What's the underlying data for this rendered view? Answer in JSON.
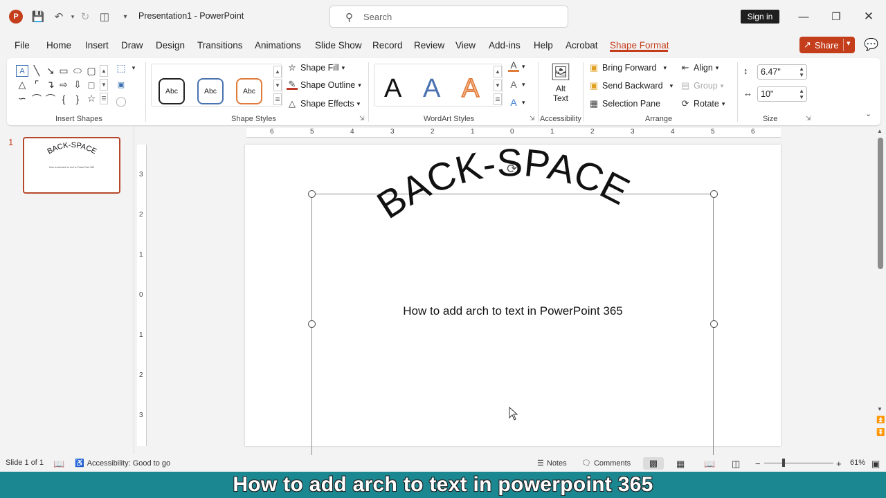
{
  "app": {
    "title": "Presentation1  -  PowerPoint",
    "logo_letter": "P",
    "search_placeholder": "Search",
    "signin": "Sign in",
    "share": "Share"
  },
  "menu": {
    "tabs": [
      "File",
      "Home",
      "Insert",
      "Draw",
      "Design",
      "Transitions",
      "Animations",
      "Slide Show",
      "Record",
      "Review",
      "View",
      "Add-ins",
      "Help",
      "Acrobat",
      "Shape Format"
    ],
    "active_tab": "Shape Format"
  },
  "ribbon": {
    "groups": {
      "insert_shapes": "Insert Shapes",
      "shape_styles": "Shape Styles",
      "wordart_styles": "WordArt Styles",
      "accessibility": "Accessibility",
      "arrange": "Arrange",
      "size": "Size"
    },
    "style_thumb_label": "Abc",
    "shape_fill": "Shape Fill",
    "shape_outline": "Shape Outline",
    "shape_effects": "Shape Effects",
    "wordart_letter": "A",
    "alt_text_line1": "Alt",
    "alt_text_line2": "Text",
    "bring_forward": "Bring Forward",
    "send_backward": "Send Backward",
    "selection_pane": "Selection Pane",
    "align": "Align",
    "group": "Group",
    "rotate": "Rotate",
    "height": "6.47\"",
    "width": "10\""
  },
  "thumbnails": {
    "slide_number": "1",
    "thumb_title": "BACK-SPACE",
    "thumb_subtitle": "How to add arch to text in PowerPoint 365"
  },
  "rulers": {
    "horizontal": [
      "6",
      "5",
      "4",
      "3",
      "2",
      "1",
      "0",
      "1",
      "2",
      "3",
      "4",
      "5",
      "6"
    ],
    "vertical": [
      "3",
      "2",
      "1",
      "0",
      "1",
      "2",
      "3"
    ]
  },
  "slide": {
    "arched_title": "BACK-SPACE",
    "subtitle": "How to add arch to text in PowerPoint 365"
  },
  "status": {
    "slide_of": "Slide 1 of 1",
    "accessibility": "Accessibility: Good to go",
    "notes": "Notes",
    "comments": "Comments",
    "zoom": "61%"
  },
  "caption": "How to add arch to text in powerpoint 365",
  "colors": {
    "accent": "#c43e1c",
    "banner": "#1b8791"
  }
}
